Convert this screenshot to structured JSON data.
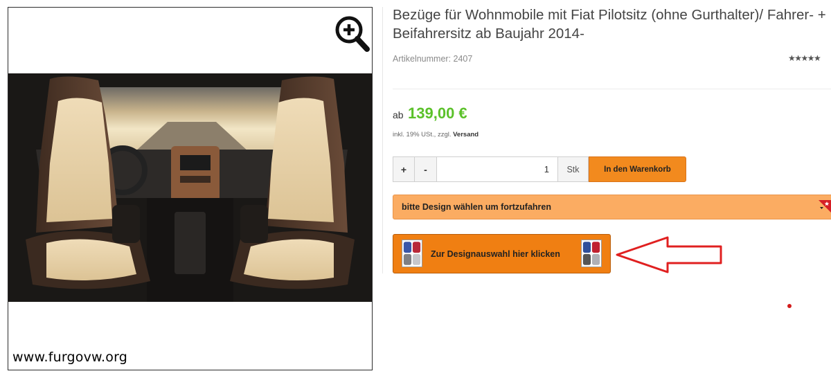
{
  "product": {
    "title": "Bezüge für Wohnmobile mit Fiat Pilotsitz (ohne Gurthalter)/ Fahrer- + Beifahrersitz ab Baujahr 2014-",
    "article_number": "Artikelnummer: 2407",
    "rating_stars": "★★★★★",
    "price_prefix": "ab",
    "price": "139,00 €",
    "tax_note": "inkl. 19% USt., zzgl.",
    "shipping_link": "Versand"
  },
  "purchase": {
    "plus_label": "+",
    "minus_label": "-",
    "quantity": "1",
    "unit": "Stk",
    "cart_label": "In den Warenkorb"
  },
  "design": {
    "select_label": "bitte Design wählen um fortzufahren",
    "button_label": "Zur Designauswahl hier klicken"
  },
  "image": {
    "watermark": "www.furgovw.org",
    "zoom_icon": "zoom-in-icon"
  },
  "colors": {
    "price_green": "#5bc12a",
    "accent_orange": "#f28a1e",
    "select_orange": "#fbac62",
    "annotation_red": "#e02020"
  }
}
